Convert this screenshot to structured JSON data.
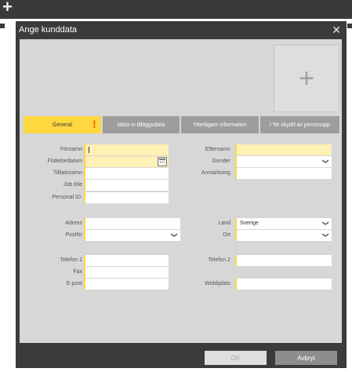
{
  "window": {
    "title": "Ange kunddata",
    "close_glyph": "✕"
  },
  "photo": {
    "icon": "plus-icon",
    "glyph": "+"
  },
  "tabs": [
    {
      "label": "General"
    },
    {
      "label": "Mata in tilläggsdata"
    },
    {
      "label": "Ytterligare information"
    },
    {
      "label": "r för skydd av personupp"
    }
  ],
  "tab_warning": "!",
  "form": {
    "firstname_label": "Förnamn",
    "lastname_label": "Efternamn",
    "birthdate_label": "Födelsedatum",
    "gender_label": "Gender",
    "title_address_label": "Tilltalsnamn",
    "note_label": "Anmärkning",
    "jobtitle_label": "Job title",
    "personalid_label": "Personal ID:",
    "address_label": "Adress",
    "country_label": "Land",
    "country_value": "Sverige",
    "zip_label": "PostNr",
    "city_label": "Ort",
    "phone1_label": "Telefon 1",
    "phone2_label": "Telefon 2",
    "fax_label": "Fax",
    "email_label": "E-post",
    "website_label": "Webbplats"
  },
  "buttons": {
    "ok": "OK",
    "cancel": "Avbryt"
  },
  "colors": {
    "accent": "#ffd73f",
    "required_bg": "#fff0b5",
    "dialog": "#3b3b3b",
    "panel": "#d7d7d7"
  }
}
